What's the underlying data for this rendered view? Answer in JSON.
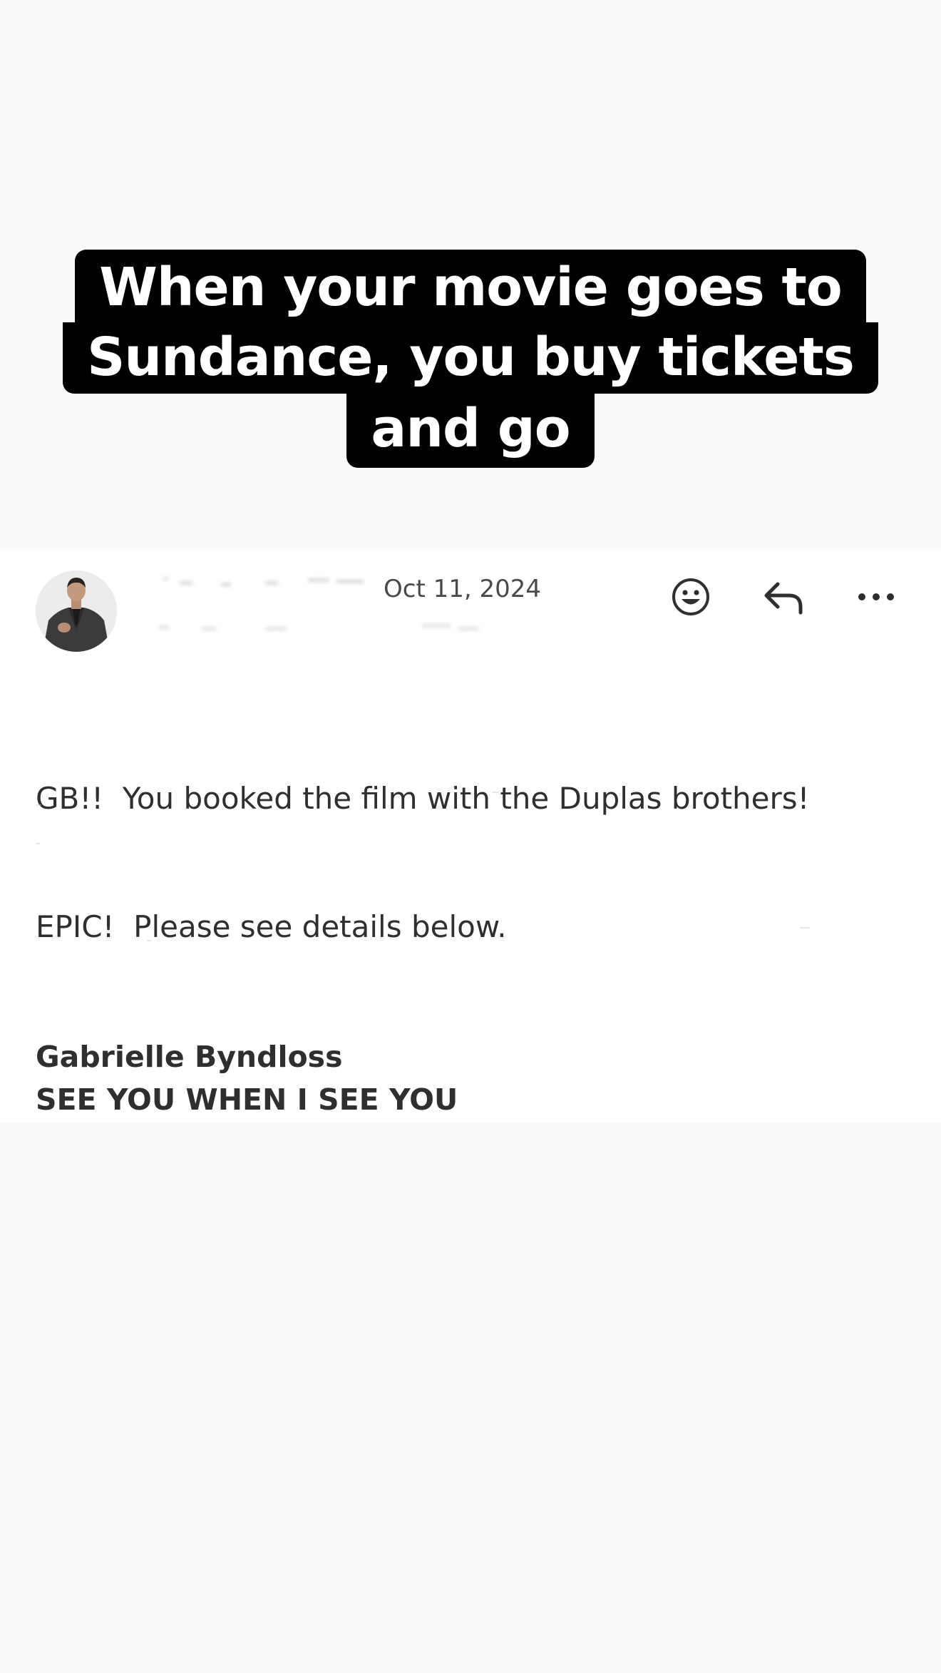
{
  "caption": {
    "line1": "When your movie goes to",
    "line2": "Sundance, you buy tickets",
    "line3": "and go"
  },
  "email": {
    "date": "Oct 11, 2024",
    "body_line1": "GB!!  You booked the film with the Duplas brothers!",
    "body_line2": "EPIC!  Please see details below.",
    "signature_name": "Gabrielle Byndloss",
    "signature_tagline": "SEE YOU WHEN I SEE YOU"
  },
  "icons": {
    "emoji": "smiley-face-icon",
    "reply": "reply-arrow-icon",
    "more": "ellipsis-icon"
  },
  "colors": {
    "caption_bg": "#000000",
    "caption_text": "#ffffff",
    "body_text": "#2f2f2f",
    "page_bg": "#fafafa",
    "card_bg": "#ffffff"
  }
}
